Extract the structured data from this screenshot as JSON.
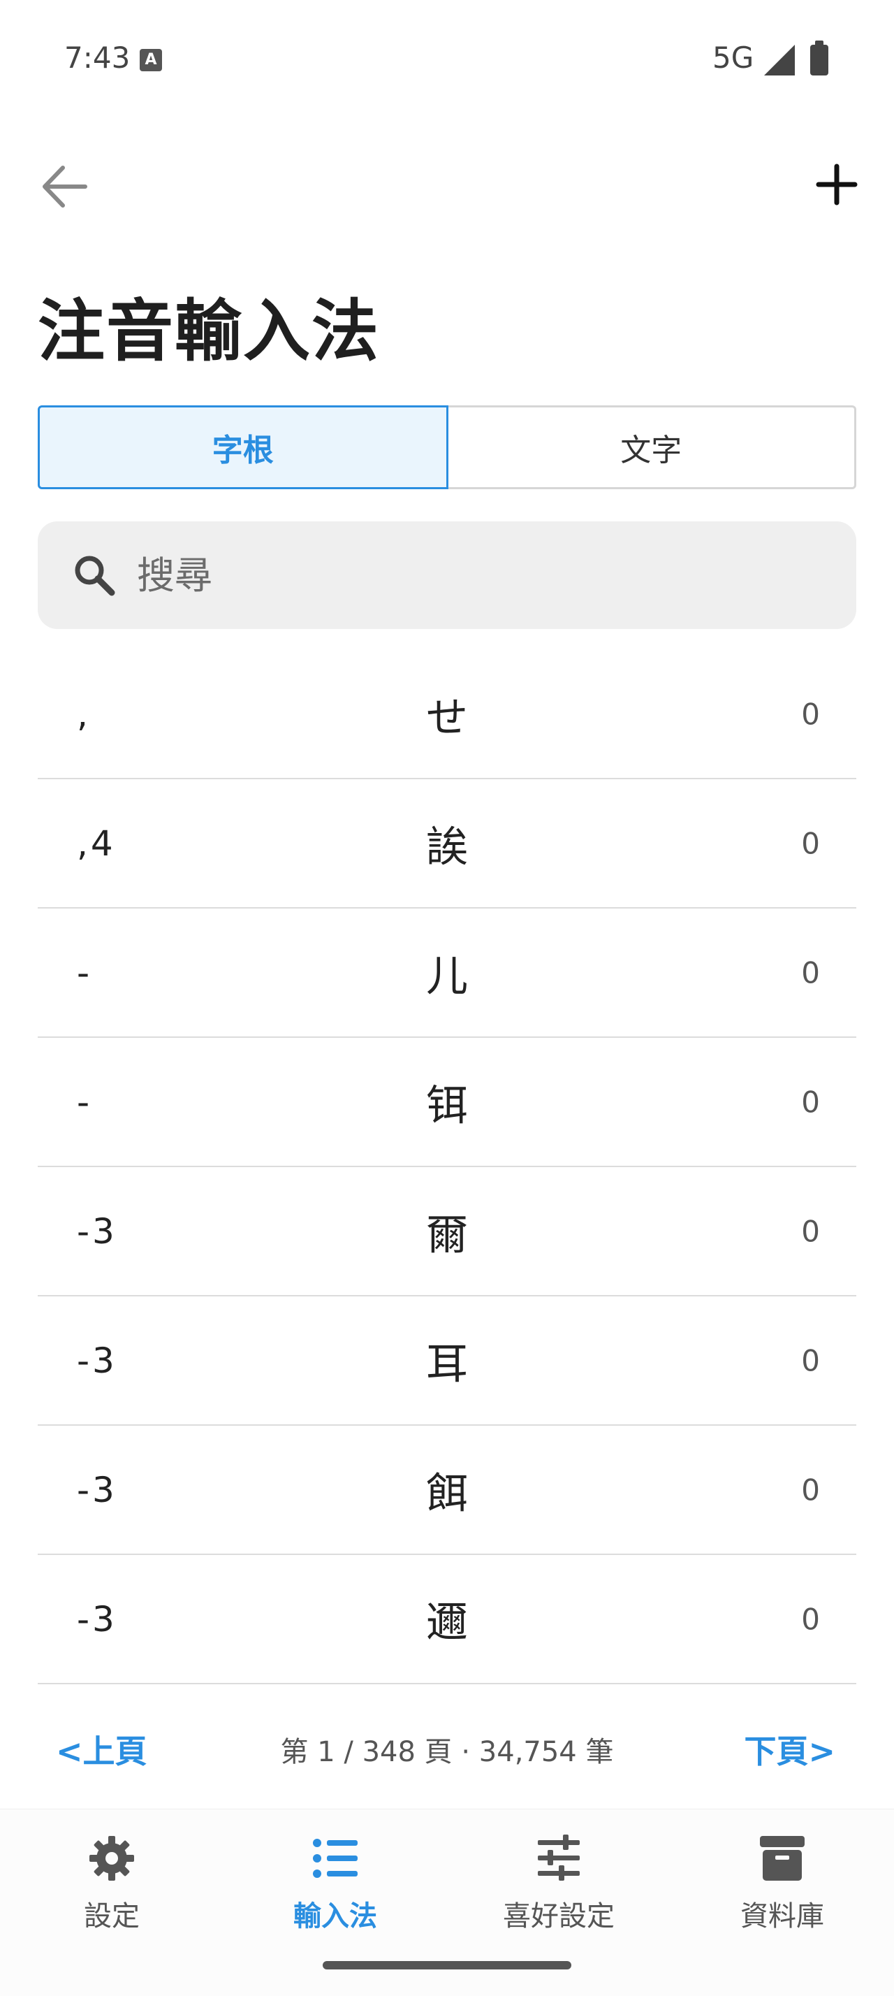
{
  "status_bar": {
    "time": "7:43",
    "network": "5G"
  },
  "header": {
    "title": "注音輸入法"
  },
  "tabs": [
    {
      "label": "字根",
      "active": true
    },
    {
      "label": "文字",
      "active": false
    }
  ],
  "search": {
    "placeholder": "搜尋",
    "value": ""
  },
  "entries": [
    {
      "code": ",",
      "char": "せ",
      "count": "0"
    },
    {
      "code": ",4",
      "char": "誒",
      "count": "0"
    },
    {
      "code": "-",
      "char": "儿",
      "count": "0"
    },
    {
      "code": "-",
      "char": "铒",
      "count": "0"
    },
    {
      "code": "-3",
      "char": "爾",
      "count": "0"
    },
    {
      "code": "-3",
      "char": "耳",
      "count": "0"
    },
    {
      "code": "-3",
      "char": "餌",
      "count": "0"
    },
    {
      "code": "-3",
      "char": "邇",
      "count": "0"
    }
  ],
  "pagination": {
    "prev_label": "<上頁",
    "info": "第 1 / 348 頁 · 34,754 筆",
    "next_label": "下頁>"
  },
  "bottom_nav": [
    {
      "label": "設定",
      "icon": "gear-icon",
      "active": false
    },
    {
      "label": "輸入法",
      "icon": "list-icon",
      "active": true
    },
    {
      "label": "喜好設定",
      "icon": "sliders-icon",
      "active": false
    },
    {
      "label": "資料庫",
      "icon": "archive-icon",
      "active": false
    }
  ],
  "colors": {
    "accent": "#2a8ee0",
    "text": "#1f1f1f",
    "muted": "#555555"
  }
}
